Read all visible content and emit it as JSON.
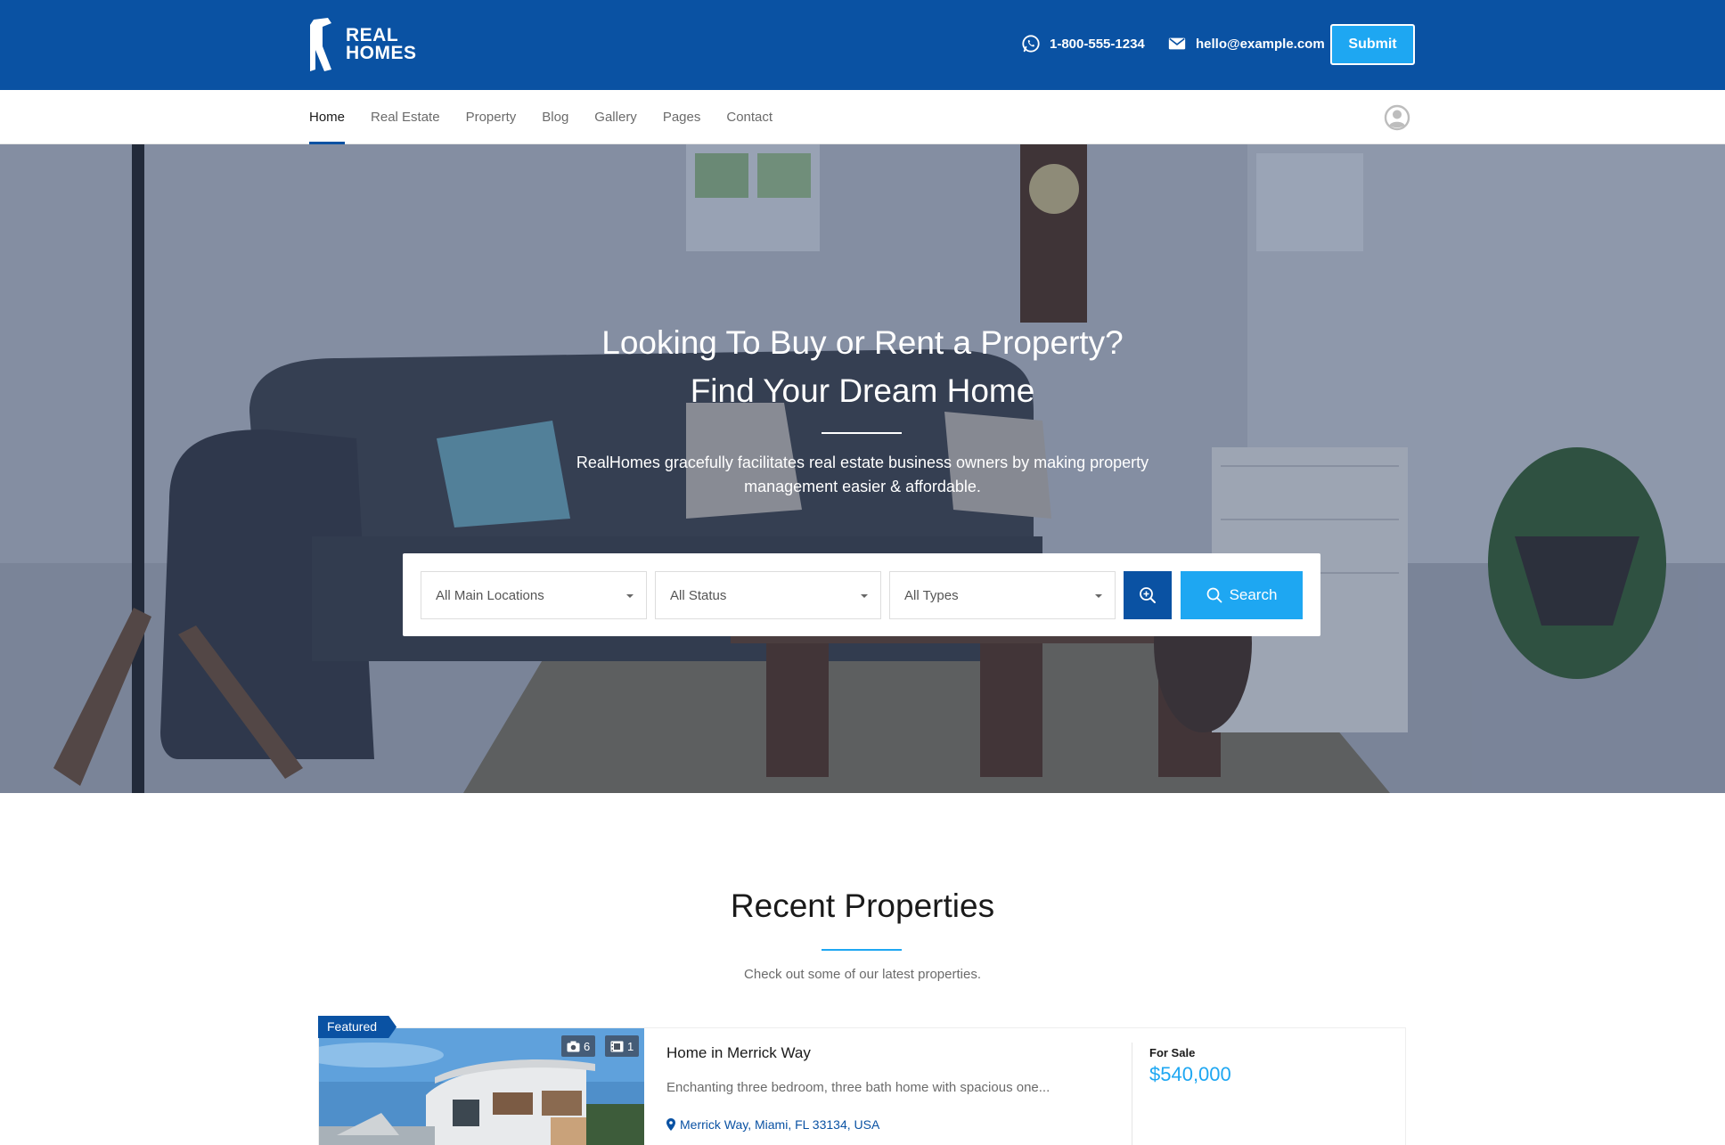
{
  "brand": {
    "logo_line1": "REAL",
    "logo_line2": "HOMES",
    "primary": "#0a52a3",
    "accent": "#1ea7f2"
  },
  "header": {
    "phone": "1-800-555-1234",
    "phone_icon": "whatsapp-icon",
    "email": "hello@example.com",
    "email_icon": "envelope-icon",
    "submit_label": "Submit"
  },
  "nav": {
    "items": [
      {
        "label": "Home",
        "active": true
      },
      {
        "label": "Real Estate"
      },
      {
        "label": "Property"
      },
      {
        "label": "Blog"
      },
      {
        "label": "Gallery"
      },
      {
        "label": "Pages"
      },
      {
        "label": "Contact"
      }
    ],
    "user_icon": "user-avatar-icon"
  },
  "hero": {
    "title_line1": "Looking To Buy or Rent a Property?",
    "title_line2": "Find Your Dream Home",
    "subtitle_line1": "RealHomes gracefully facilitates real estate business owners by making property",
    "subtitle_line2": "management easier & affordable."
  },
  "search": {
    "location": "All Main Locations",
    "status": "All Status",
    "type": "All Types",
    "advanced_icon": "zoom-in-icon",
    "button_label": "Search"
  },
  "recent": {
    "title": "Recent Properties",
    "subtitle": "Check out some of our latest properties."
  },
  "property": {
    "badge": "Featured",
    "photos_count": "6",
    "videos_count": "1",
    "title": "Home in Merrick Way",
    "description": "Enchanting three bedroom, three bath home with spacious one...",
    "location": "Merrick Way, Miami, FL 33134, USA",
    "status": "For Sale",
    "price": "$540,000"
  }
}
